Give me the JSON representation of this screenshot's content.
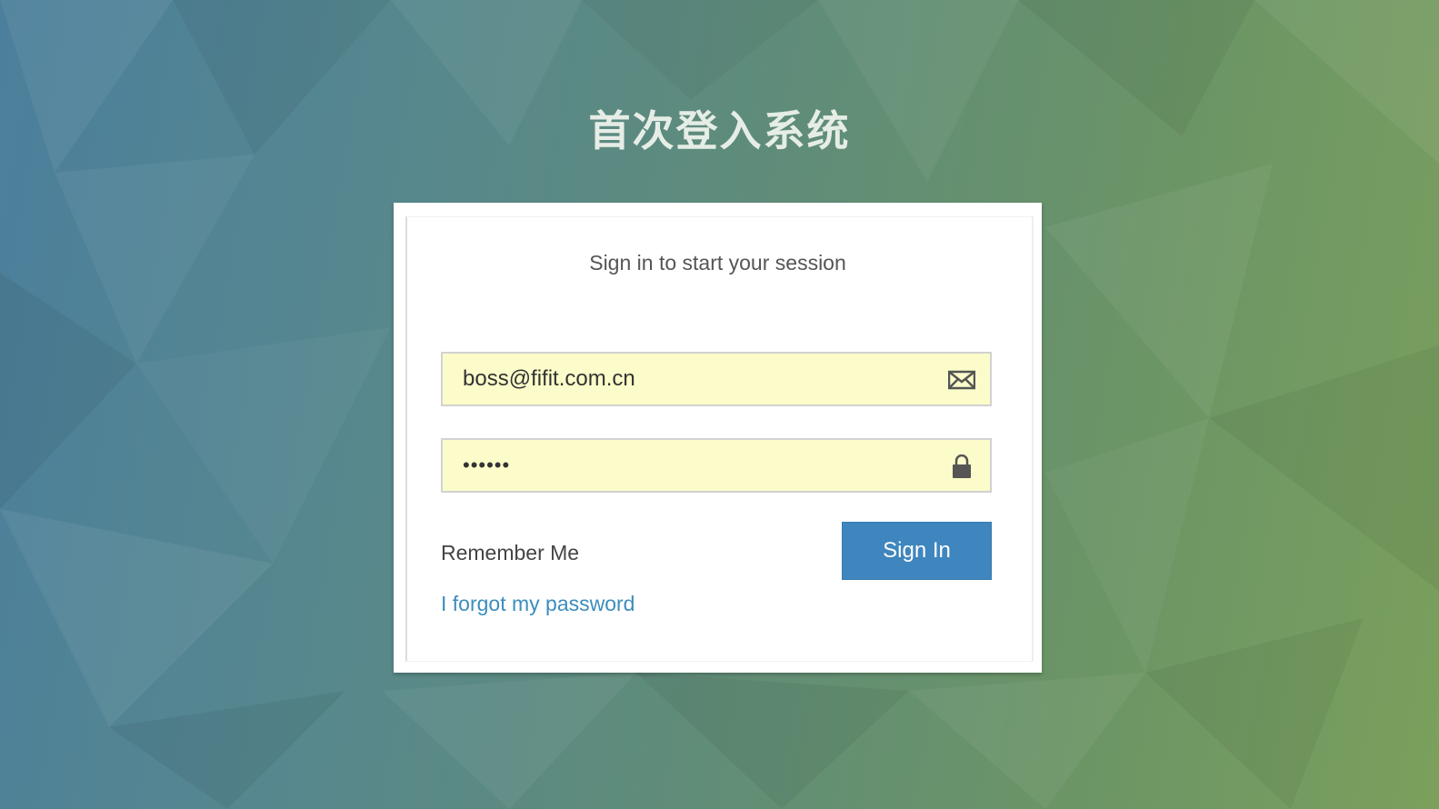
{
  "page": {
    "title": "首次登入系统"
  },
  "login": {
    "subtitle": "Sign in to start your session",
    "email": {
      "value": "boss@fifit.com.cn",
      "icon": "envelope-icon"
    },
    "password": {
      "value": "••••••",
      "icon": "lock-icon"
    },
    "remember_label": "Remember Me",
    "signin_label": "Sign In",
    "forgot_label": "I forgot my password"
  },
  "colors": {
    "field_bg": "#fbfcc9",
    "button_bg": "#3f86be",
    "link": "#3c8dbc"
  }
}
